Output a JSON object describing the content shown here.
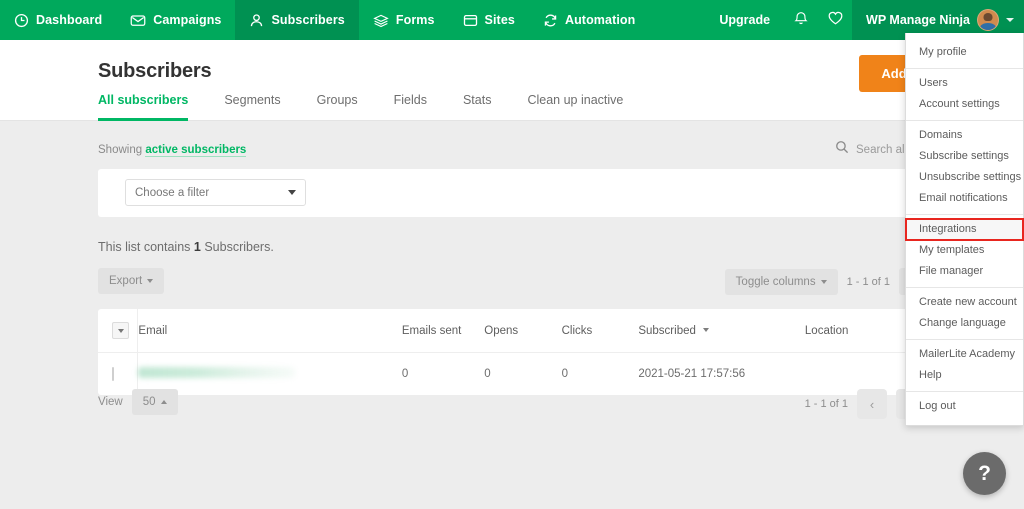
{
  "topnav": {
    "items": [
      {
        "label": "Dashboard",
        "icon": "clock-icon",
        "active": false
      },
      {
        "label": "Campaigns",
        "icon": "envelope-icon",
        "active": false
      },
      {
        "label": "Subscribers",
        "icon": "person-icon",
        "active": true
      },
      {
        "label": "Forms",
        "icon": "layers-icon",
        "active": false
      },
      {
        "label": "Sites",
        "icon": "window-icon",
        "active": false
      },
      {
        "label": "Automation",
        "icon": "refresh-icon",
        "active": false
      }
    ],
    "upgrade_label": "Upgrade",
    "bell_icon": "bell-icon",
    "heart_icon": "heart-icon",
    "user_name": "WP Manage Ninja",
    "brand_color": "#00a95c",
    "active_color": "#009152"
  },
  "user_menu": {
    "groups": [
      {
        "items": [
          {
            "label": "My profile",
            "highlighted": false
          }
        ]
      },
      {
        "items": [
          {
            "label": "Users",
            "highlighted": false
          },
          {
            "label": "Account settings",
            "highlighted": false
          }
        ]
      },
      {
        "items": [
          {
            "label": "Domains",
            "highlighted": false
          },
          {
            "label": "Subscribe settings",
            "highlighted": false
          },
          {
            "label": "Unsubscribe settings",
            "highlighted": false
          },
          {
            "label": "Email notifications",
            "highlighted": false
          }
        ]
      },
      {
        "items": [
          {
            "label": "Integrations",
            "highlighted": true
          },
          {
            "label": "My templates",
            "highlighted": false
          },
          {
            "label": "File manager",
            "highlighted": false
          }
        ]
      },
      {
        "items": [
          {
            "label": "Create new account",
            "highlighted": false
          },
          {
            "label": "Change language",
            "highlighted": false
          }
        ]
      },
      {
        "items": [
          {
            "label": "MailerLite Academy",
            "highlighted": false
          },
          {
            "label": "Help",
            "highlighted": false
          }
        ]
      },
      {
        "items": [
          {
            "label": "Log out",
            "highlighted": false
          }
        ]
      }
    ],
    "highlight_color": "#e8261f"
  },
  "page": {
    "title": "Subscribers",
    "add_button_label": "Add subscribers",
    "add_button_color": "#f08319",
    "tabs": [
      {
        "label": "All subscribers",
        "active": true
      },
      {
        "label": "Segments",
        "active": false
      },
      {
        "label": "Groups",
        "active": false
      },
      {
        "label": "Fields",
        "active": false
      },
      {
        "label": "Stats",
        "active": false
      },
      {
        "label": "Clean up inactive",
        "active": false
      }
    ],
    "tab_active_color": "#00b764"
  },
  "showing": {
    "prefix": "Showing",
    "link": "active subscribers"
  },
  "search": {
    "icon": "search-icon",
    "placeholder": "Search all subscribers",
    "value": ""
  },
  "filter": {
    "placeholder": "Choose a filter"
  },
  "list_summary": {
    "prefix": "This list contains",
    "count": "1",
    "suffix": "Subscribers."
  },
  "toolbar": {
    "export_label": "Export",
    "toggle_columns_label": "Toggle columns",
    "page_info": "1 - 1 of 1",
    "prev_label": "‹"
  },
  "table": {
    "columns": [
      "Email",
      "Emails sent",
      "Opens",
      "Clicks",
      "Subscribed",
      "Location"
    ],
    "sorted_column": "Subscribed",
    "rows": [
      {
        "email": "",
        "email_redacted": true,
        "emails_sent": "0",
        "opens": "0",
        "clicks": "0",
        "subscribed": "2021-05-21 17:57:56",
        "location": ""
      }
    ]
  },
  "footer": {
    "view_label": "View",
    "view_value": "50",
    "page_info": "1 - 1 of 1",
    "prev_label": "‹",
    "next_label": "›"
  },
  "help": {
    "label": "?"
  }
}
